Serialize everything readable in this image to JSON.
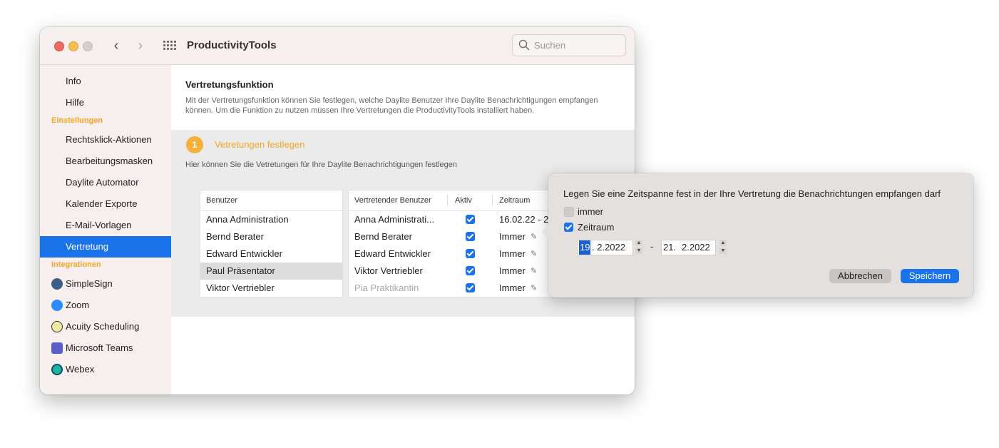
{
  "window": {
    "title": "ProductivityTools"
  },
  "search": {
    "placeholder": "Suchen"
  },
  "sidebar": {
    "top_items": [
      {
        "label": "Info"
      },
      {
        "label": "Hilfe"
      }
    ],
    "section_settings": "Einstellungen",
    "settings_items": [
      {
        "label": "Rechtsklick-Aktionen"
      },
      {
        "label": "Bearbeitungsmasken"
      },
      {
        "label": "Daylite Automator"
      },
      {
        "label": "Kalender Exporte"
      },
      {
        "label": "E-Mail-Vorlagen"
      },
      {
        "label": "Vertretung",
        "active": true
      }
    ],
    "section_integrations": "Integrationen",
    "integration_items": [
      {
        "label": "SimpleSign",
        "icon": "simplesign-icon"
      },
      {
        "label": "Zoom",
        "icon": "zoom-icon"
      },
      {
        "label": "Acuity Scheduling",
        "icon": "acuity-icon"
      },
      {
        "label": "Microsoft Teams",
        "icon": "teams-icon"
      },
      {
        "label": "Webex",
        "icon": "webex-icon"
      }
    ]
  },
  "main": {
    "title": "Vertretungsfunktion",
    "description": "Mit der Vertretungsfunktion können Sie festlegen, welche Daylite Benutzer Ihre Daylite Benachrichtigungen empfangen können. Um die Funktion zu nutzen müssen Ihre Vertretungen die ProductivityTools installiert haben.",
    "step": {
      "number": "1",
      "label": "Vetretungen festlegen",
      "description": "Hier können Sie die Vetretungen für Ihre Daylite Benachrichtigungen festlegen"
    },
    "users_table": {
      "header": "Benutzer",
      "rows": [
        {
          "name": "Anna Administration"
        },
        {
          "name": "Bernd Berater"
        },
        {
          "name": "Edward Entwickler"
        },
        {
          "name": "Paul Präsentator",
          "selected": true
        },
        {
          "name": "Viktor Vertriebler"
        }
      ]
    },
    "deputies_table": {
      "headers": {
        "deputy": "Vertretender Benutzer",
        "active": "Aktiv",
        "period": "Zeitraum"
      },
      "rows": [
        {
          "deputy": "Anna Administrati...",
          "active": true,
          "period": "16.02.22 - 21.02.22",
          "muted": false
        },
        {
          "deputy": "Bernd Berater",
          "active": true,
          "period": "Immer",
          "muted": false
        },
        {
          "deputy": "Edward Entwickler",
          "active": true,
          "period": "Immer",
          "muted": false
        },
        {
          "deputy": "Viktor Vertriebler",
          "active": true,
          "period": "Immer",
          "muted": false
        },
        {
          "deputy": "Pia Praktikantin",
          "active": true,
          "period": "Immer",
          "muted": true
        }
      ]
    }
  },
  "popover": {
    "title": "Legen Sie eine Zeitspanne fest in der Ihre Vertretung die Benachrichtungen empfangen darf",
    "option_always": {
      "label": "immer",
      "checked": false
    },
    "option_period": {
      "label": "Zeitraum",
      "checked": true
    },
    "from_date": {
      "day": "19",
      "rest": ". 2.2022"
    },
    "separator": "-",
    "to_date": {
      "day": "21.",
      "rest": "2.2022"
    },
    "cancel_label": "Abbrechen",
    "save_label": "Speichern"
  },
  "colors": {
    "accent": "#1a73e8",
    "orange": "#f5a623",
    "sidebar_bg": "#f7eeee"
  }
}
